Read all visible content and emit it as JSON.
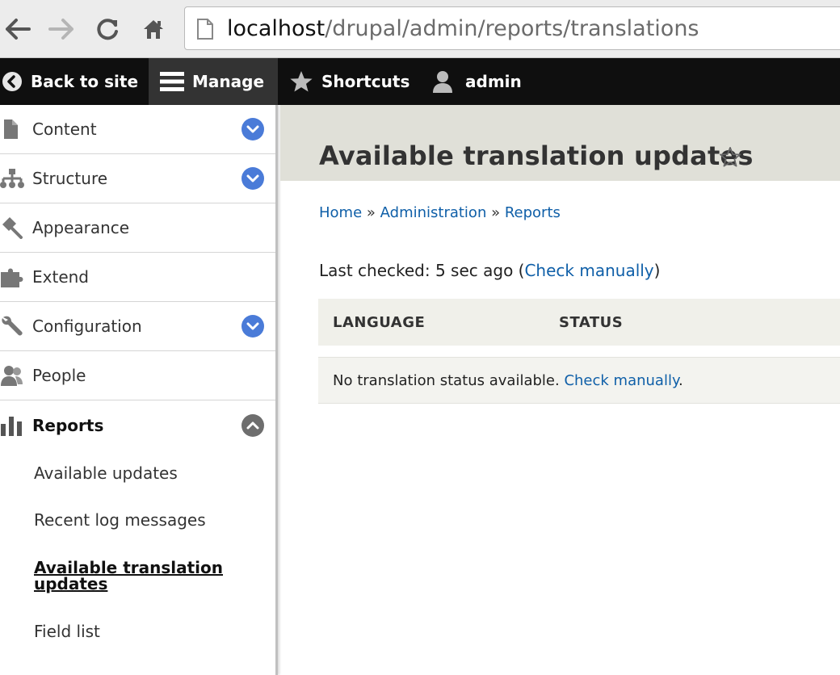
{
  "browser": {
    "url_host": "localhost",
    "url_path": "/drupal/admin/reports/translations"
  },
  "toolbar": {
    "back_label": "Back to site",
    "manage_label": "Manage",
    "shortcuts_label": "Shortcuts",
    "user_label": "admin"
  },
  "sidebar": {
    "items": [
      {
        "label": "Content"
      },
      {
        "label": "Structure"
      },
      {
        "label": "Appearance"
      },
      {
        "label": "Extend"
      },
      {
        "label": "Configuration"
      },
      {
        "label": "People"
      },
      {
        "label": "Reports"
      }
    ],
    "sub_items": [
      {
        "label": "Available updates"
      },
      {
        "label": "Recent log messages"
      },
      {
        "label": "Available translation updates"
      },
      {
        "label": "Field list"
      }
    ]
  },
  "page": {
    "title": "Available translation updates",
    "breadcrumb": {
      "home": "Home",
      "administration": "Administration",
      "reports": "Reports",
      "separator": "»"
    },
    "last_checked_prefix": "Last checked: 5 sec ago (",
    "last_checked_link": "Check manually",
    "last_checked_suffix": ")",
    "table": {
      "headers": [
        "LANGUAGE",
        "STATUS"
      ],
      "empty_text": "No translation status available.",
      "empty_link": "Check manually",
      "empty_suffix": "."
    }
  },
  "colors": {
    "toolbar_bg": "#0f0f0f",
    "link": "#0f5fa8",
    "toggle_blue": "#4a7bd8",
    "header_band": "#e0e0d8"
  }
}
